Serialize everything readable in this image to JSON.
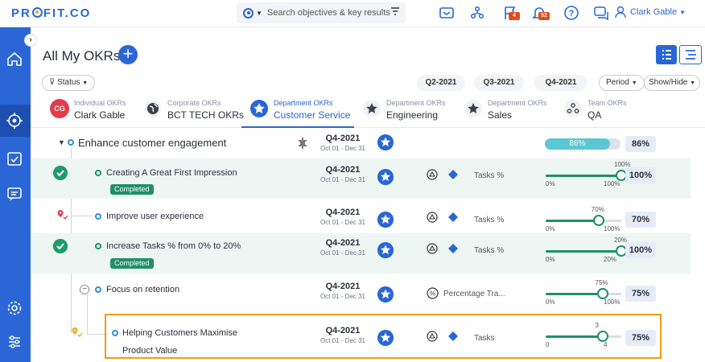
{
  "app": {
    "logo": "PROFIT.CO"
  },
  "topbar": {
    "search_placeholder": "Search objectives & key results",
    "user_name": "Clark Gable",
    "badges": {
      "tasks": "4",
      "alerts": "52"
    }
  },
  "page": {
    "title": "All My OKRs"
  },
  "filters": {
    "status": "Status",
    "quarters": [
      "Q2-2021",
      "Q3-2021",
      "Q4-2021"
    ],
    "period": "Period",
    "show_hide": "Show/Hide"
  },
  "tabs": [
    {
      "top": "Individual OKRs",
      "bottom": "Clark Gable",
      "initials": "CG"
    },
    {
      "top": "Corporate OKRs",
      "bottom": "BCT TECH OKRs"
    },
    {
      "top": "Department OKRs",
      "bottom": "Customer Service"
    },
    {
      "top": "Department OKRs",
      "bottom": "Engineering"
    },
    {
      "top": "Department OKRs",
      "bottom": "Sales"
    },
    {
      "top": "Team OKRs",
      "bottom": "QA"
    }
  ],
  "objective": {
    "title": "Enhance customer engagement",
    "quarter": "Q4-2021",
    "dates": "Oct 01 - Dec 31",
    "progress_label": "86%",
    "progress": 0.86,
    "pct": "86%"
  },
  "key_results": [
    {
      "title": "Creating A Great First Impression",
      "tag": "Completed",
      "quarter": "Q4-2021",
      "dates": "Oct 01 - Dec 31",
      "metric": "Tasks %",
      "min": "0%",
      "max": "100%",
      "value_label": "100%",
      "value": 1.0,
      "pct": "100%"
    },
    {
      "title": "Improve user experience",
      "quarter": "Q4-2021",
      "dates": "Oct 01 - Dec 31",
      "metric": "Tasks %",
      "min": "0%",
      "max": "100%",
      "value_label": "70%",
      "value": 0.7,
      "pct": "70%"
    },
    {
      "title": "Increase Tasks % from 0% to 20%",
      "tag": "Completed",
      "quarter": "Q4-2021",
      "dates": "Oct 01 - Dec 31",
      "metric": "Tasks %",
      "min": "0%",
      "max": "20%",
      "value_label": "20%",
      "value": 1.0,
      "pct": "100%"
    },
    {
      "title": "Focus on retention",
      "quarter": "Q4-2021",
      "dates": "Oct 01 - Dec 31",
      "metric": "Percentage Tra...",
      "min": "0%",
      "max": "100%",
      "value_label": "75%",
      "value": 0.75,
      "pct": "75%"
    },
    {
      "title": "Helping Customers Maximise",
      "title2": "Product Value",
      "quarter": "Q4-2021",
      "dates": "Oct 01 - Dec 31",
      "metric": "Tasks",
      "min": "0",
      "max": "4",
      "value_label": "3",
      "value": 0.75,
      "pct": "75%"
    }
  ],
  "colors": {
    "primary": "#2a66d6",
    "success": "#1f8f6a",
    "highlight": "#f39c12"
  }
}
